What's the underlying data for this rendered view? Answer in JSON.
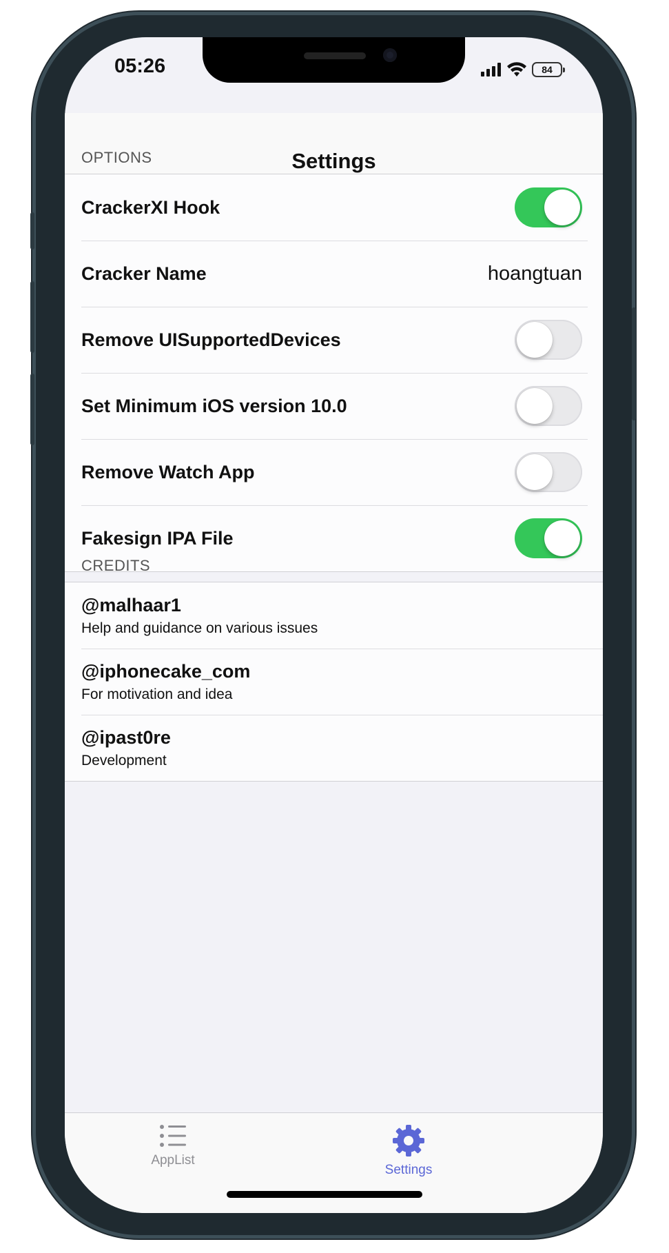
{
  "status_bar": {
    "time": "05:26",
    "battery": "84"
  },
  "nav": {
    "title": "Settings"
  },
  "options": {
    "header": "OPTIONS",
    "rows": [
      {
        "label": "CrackerXI Hook",
        "type": "toggle",
        "on": true
      },
      {
        "label": "Cracker Name",
        "type": "value",
        "value": "hoangtuan"
      },
      {
        "label": "Remove UISupportedDevices",
        "type": "toggle",
        "on": false
      },
      {
        "label": "Set Minimum iOS version 10.0",
        "type": "toggle",
        "on": false
      },
      {
        "label": "Remove Watch App",
        "type": "toggle",
        "on": false
      },
      {
        "label": "Fakesign IPA File",
        "type": "toggle",
        "on": true
      }
    ]
  },
  "credits": {
    "header": "CREDITS",
    "items": [
      {
        "title": "@malhaar1",
        "subtitle": "Help and guidance on various issues"
      },
      {
        "title": "@iphonecake_com",
        "subtitle": "For motivation and idea"
      },
      {
        "title": "@ipast0re",
        "subtitle": "Development"
      }
    ]
  },
  "tab_bar": {
    "tabs": [
      {
        "label": "AppList",
        "icon": "list-icon",
        "active": false
      },
      {
        "label": "Settings",
        "icon": "gear-icon",
        "active": true
      }
    ]
  },
  "colors": {
    "toggle_on": "#34c759",
    "tab_active": "#5b67d6",
    "tab_inactive": "#8e8e93"
  }
}
